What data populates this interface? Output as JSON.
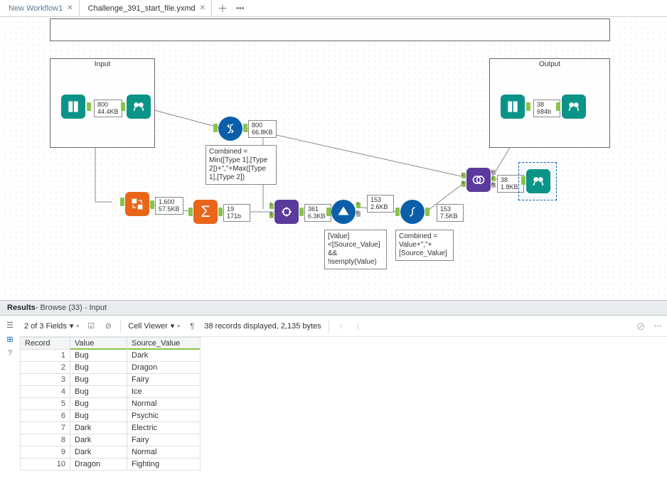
{
  "tabs": [
    {
      "label": "New Workflow1",
      "active": false
    },
    {
      "label": "Challenge_391_start_file.yxmd",
      "active": true
    }
  ],
  "canvas": {
    "input_container_title": "Input",
    "output_container_title": "Output",
    "metrics": {
      "input_browse": {
        "count": "800",
        "size": "44.4KB"
      },
      "formula1": {
        "count": "800",
        "size": "66.8KB"
      },
      "transpose": {
        "count": "1,600",
        "size": "57.5KB"
      },
      "summarize": {
        "count": "19",
        "size": "171b"
      },
      "multifield": {
        "count": "361",
        "size": "6.3KB"
      },
      "filter_top": {
        "count": "153",
        "size": "2.6KB"
      },
      "formula2": {
        "count": "153",
        "size": "7.5KB"
      },
      "join": {
        "count": "38",
        "size": "1.8KB"
      },
      "output_browse": {
        "count": "38",
        "size": "684b"
      }
    },
    "annotations": {
      "formula1": "Combined = Min([Type 1],[Type 2])+\",\"+Max([Type 1],[Type 2])",
      "filter": "[Value]<[Source_Value] && !isempty(Value)",
      "formula2": "Combined = Value+\",\"+[Source_Value]"
    }
  },
  "results": {
    "header_label": "Results",
    "header_sub": " - Browse (33) - Input",
    "fields_dd": "2 of 3 Fields",
    "cell_viewer": "Cell Viewer",
    "status": "38 records displayed, 2,135 bytes",
    "columns": [
      "Record",
      "Value",
      "Source_Value"
    ],
    "rows": [
      {
        "n": "1",
        "value": "Bug",
        "source": "Dark"
      },
      {
        "n": "2",
        "value": "Bug",
        "source": "Dragon"
      },
      {
        "n": "3",
        "value": "Bug",
        "source": "Fairy"
      },
      {
        "n": "4",
        "value": "Bug",
        "source": "Ice"
      },
      {
        "n": "5",
        "value": "Bug",
        "source": "Normal"
      },
      {
        "n": "6",
        "value": "Bug",
        "source": "Psychic"
      },
      {
        "n": "7",
        "value": "Dark",
        "source": "Electric"
      },
      {
        "n": "8",
        "value": "Dark",
        "source": "Fairy"
      },
      {
        "n": "9",
        "value": "Dark",
        "source": "Normal"
      },
      {
        "n": "10",
        "value": "Dragon",
        "source": "Fighting"
      }
    ]
  }
}
